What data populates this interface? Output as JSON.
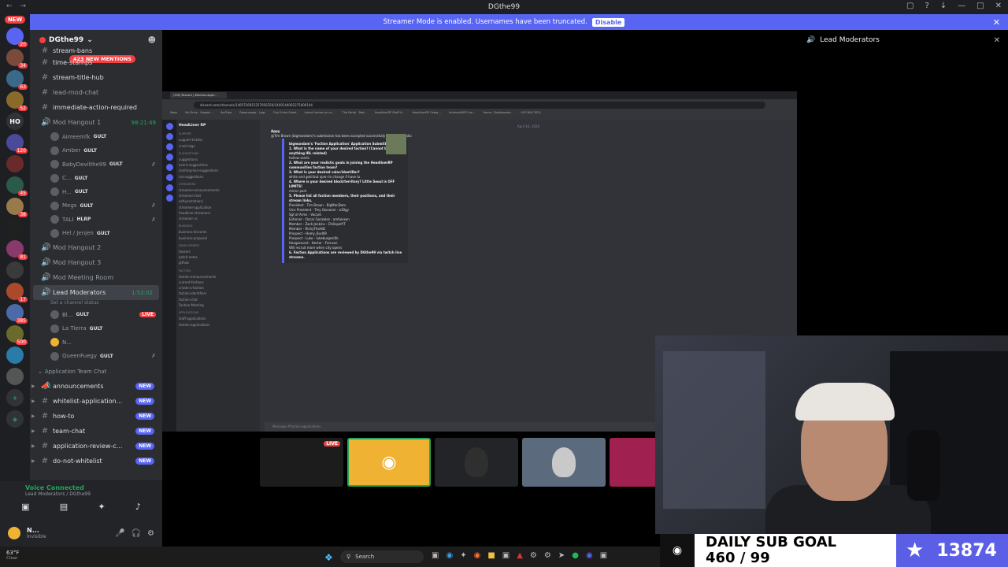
{
  "window": {
    "title": "DGthe99"
  },
  "banner": {
    "text": "Streamer Mode is enabled. Usernames have been truncated.",
    "button": "Disable"
  },
  "guilds": {
    "new_label": "NEW",
    "counts": [
      "20",
      "34",
      "63",
      "52",
      "120",
      "45",
      "38",
      "81",
      "17",
      "385",
      "500"
    ],
    "ho_label": "HO"
  },
  "server": {
    "name": "DGthe99",
    "mentions": "423 NEW MENTIONS",
    "channels": [
      {
        "name": "stream-bans"
      },
      {
        "name": "time-stamps"
      },
      {
        "name": "stream-title-hub"
      },
      {
        "name": "lead-mod-chat"
      },
      {
        "name": "immediate-action-required"
      }
    ],
    "voice_channels": [
      {
        "name": "Mod Hangout 1",
        "time": "98:21:49"
      },
      {
        "name": "Mod Hangout 2"
      },
      {
        "name": "Mod Hangout 3"
      },
      {
        "name": "Mod Meeting Room"
      },
      {
        "name": "Lead Moderators",
        "time": "1:52:02",
        "status": "Set a channel status"
      }
    ],
    "hangout_users": [
      {
        "name": "Aimeemfk",
        "tag": "GULT"
      },
      {
        "name": "Amber",
        "tag": "GULT"
      },
      {
        "name": "BabyDevilthe99",
        "tag": "GULT"
      },
      {
        "name": "C...",
        "tag": "GULT"
      },
      {
        "name": "H...",
        "tag": "GULT"
      },
      {
        "name": "Megs",
        "tag": "GULT"
      },
      {
        "name": "TALI",
        "tag": "HLRP"
      },
      {
        "name": "Hel / Jenjen",
        "tag": "GULT"
      }
    ],
    "lead_users": [
      {
        "name": "Bl...",
        "tag": "GULT",
        "live": "LIVE"
      },
      {
        "name": "La Tierra",
        "tag": "GULT"
      },
      {
        "name": "N..."
      },
      {
        "name": "QueenFuegy",
        "tag": "GULT"
      }
    ],
    "category": "Application Team Chat",
    "team_channels": [
      {
        "name": "announcements",
        "badge": "NEW"
      },
      {
        "name": "whitelist-application...",
        "badge": "NEW"
      },
      {
        "name": "how-to",
        "badge": "NEW"
      },
      {
        "name": "team-chat",
        "badge": "NEW"
      },
      {
        "name": "application-review-c...",
        "badge": "NEW"
      },
      {
        "name": "do-not-whitelist",
        "badge": "NEW"
      }
    ]
  },
  "voice_panel": {
    "status": "Voice Connected",
    "location": "Lead Moderators / DGthe99"
  },
  "user": {
    "name": "N...",
    "status": "Invisible"
  },
  "call": {
    "channel": "Lead Moderators"
  },
  "shared_screen": {
    "browser_tab": "(590) Discord | #faction-appli...",
    "url": "discord.com/channels/1405716915257056256/1409144002275000144",
    "bookmarks": [
      "Maps",
      "My Drive - Google...",
      "YouTube",
      "Powerusage - Logs",
      "Cop Crime Sheet",
      "Latest frames on ca...",
      "The Portal - Red...",
      "HeadlinerRP Staff H...",
      "HeadlinerRP Categ...",
      "Untimed/ARP Lim...",
      "Home - Dashboards...",
      "LEO BUS 2025"
    ],
    "server_name": "HeadLiner RP",
    "channel": "faction-applications",
    "app_categories": [
      "Support",
      "Suggestions",
      "Streamers",
      "Business",
      "Development",
      "Faction",
      "Applications"
    ],
    "app_channels": [
      "support-tickets",
      "crash-logs",
      "suggestions",
      "event-suggestions",
      "clothing-hair-suggestions",
      "car-suggestions",
      "streamer-announcements",
      "streamer-chat",
      "self-promotions",
      "streamer-application",
      "headliner-streamers",
      "streamer vc",
      "business-discords",
      "business-proposal",
      "teasers",
      "patch-notes",
      "github",
      "faction-announcements",
      "current-factions",
      "create-a-faction",
      "faction-identifiers",
      "faction-chat",
      "Faction Meeting",
      "staff-applications",
      "faction-applications"
    ],
    "date": "April 16, 2026",
    "author": "Appy",
    "accepted": "@Tim Brown (bigmandam)'s submission has been accepted successfully by @ModeRadio",
    "embed_title": "bigmandam's 'Faction Application' Application Submitted",
    "lines": [
      "1. What is the name of your desired faction? (Cannot be anything IRL related)",
      "hollow saints",
      "2. What are your realistic goals in joining the HeadlinerRP communities faction team?",
      "3. What is your desired color/identifier?",
      "white and gold but open to change if have to",
      "4. Where is your desired block/territory? Little Seoul is OFF LIMITS!",
      "mirror park",
      "5. Please list all faction members, their positions, and their stream links.",
      "President - Tim Brown - BigManDam",
      "Vice President - Trey Giovanni - a30gy",
      "Sgt of Arms - Vacant",
      "Enforcer - Oscar Gonzalez - amfulesen",
      "Member - Zack Jenkins - ChillspotYT",
      "Member - RichyThaHitt",
      "Prospect - Hemy_Bud09",
      "Prospect - Luke - lukeburgeslife",
      "Hangaround - Hector - Ferrussi",
      "Will recruit more when city opens",
      "6. Faction Applications are reviewed by DGthe99 via twitch live streams."
    ],
    "input_placeholder": "Message #faction-applications"
  },
  "tiles": {
    "live": "LIVE"
  },
  "sub_goal": {
    "title": "DAILY SUB GOAL",
    "progress": "460 / 99",
    "total": "13874"
  },
  "taskbar": {
    "temp": "63°F",
    "condition": "Clear",
    "search": "Search"
  }
}
